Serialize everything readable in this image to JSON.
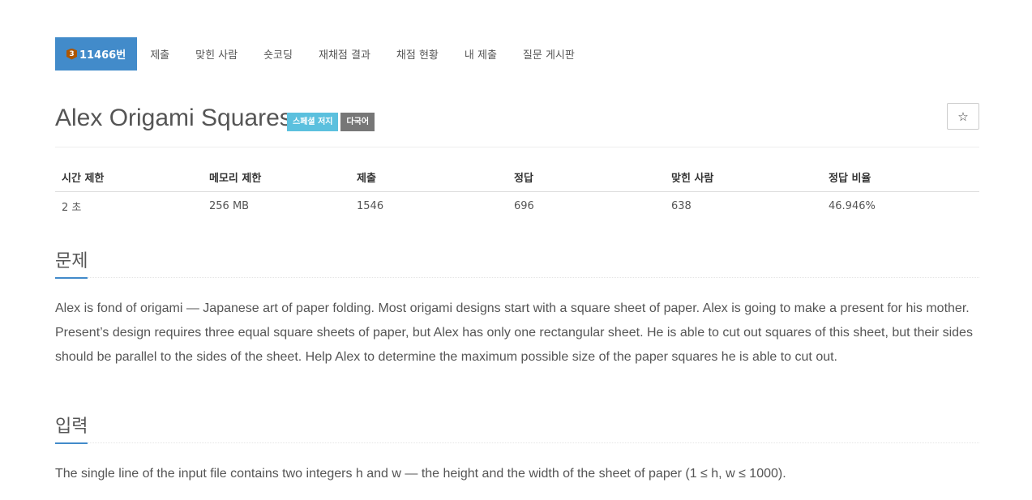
{
  "tabs": {
    "problem_tier": "3",
    "problem_number": "11466번",
    "items": [
      "제출",
      "맞힌 사람",
      "숏코딩",
      "재채점 결과",
      "채점 현황",
      "내 제출",
      "질문 게시판"
    ]
  },
  "problem": {
    "title": "Alex Origami Squares",
    "badges": [
      "스페셜 저지",
      "다국어"
    ],
    "star": "☆"
  },
  "stats": {
    "headers": [
      "시간 제한",
      "메모리 제한",
      "제출",
      "정답",
      "맞힌 사람",
      "정답 비율"
    ],
    "values": [
      "2 초",
      "256 MB",
      "1546",
      "696",
      "638",
      "46.946%"
    ]
  },
  "sections": {
    "description": {
      "heading": "문제",
      "text": "Alex is fond of origami — Japanese art of paper folding. Most origami designs start with a square sheet of paper. Alex is going to make a present for his mother. Present’s design requires three equal square sheets of paper, but Alex has only one rectangular sheet. He is able to cut out squares of this sheet, but their sides should be parallel to the sides of the sheet. Help Alex to determine the maximum possible size of the paper squares he is able to cut out."
    },
    "input": {
      "heading": "입력",
      "text": "The single line of the input file contains two integers h and w — the height and the width of the sheet of paper (1 ≤ h, w ≤ 1000)."
    }
  },
  "colors": {
    "accent": "#428bca",
    "badge_info": "#5bc0de",
    "badge_gray": "#777777",
    "tier_bronze": "#ad5600"
  }
}
